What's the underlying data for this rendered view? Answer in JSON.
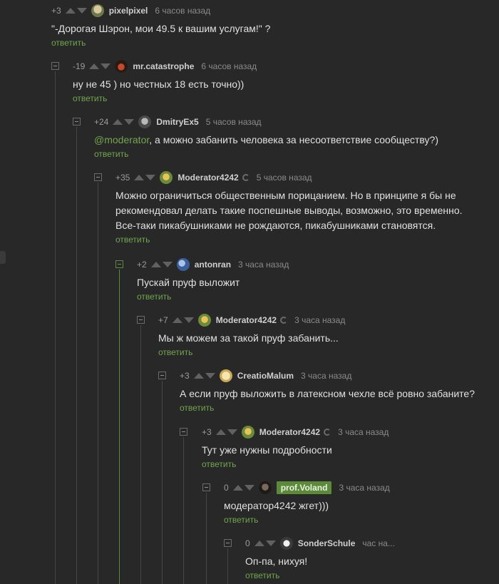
{
  "colors": {
    "background": "#282828",
    "accent": "#5b8a3a",
    "link": "#6fa64b",
    "text": "#e0e0e0",
    "muted": "#8a8a8a"
  },
  "comments": [
    {
      "rating": "+3",
      "username": "pixelpixel",
      "time": "6 часов назад",
      "text": "\"-Дорогая Шэрон, мои 49.5 к вашим услугам!\" ?",
      "reply": "ответить"
    },
    {
      "rating": "-19",
      "username": "mr.catastrophe",
      "time": "6 часов назад",
      "text": "ну не 45 ) но честных 18  есть точно))",
      "reply": "ответить"
    },
    {
      "rating": "+24",
      "username": "DmitryEx5",
      "time": "5 часов назад",
      "mention": "@moderator",
      "text": ", а можно забанить человека за несоответствие сообществу?)",
      "reply": "ответить"
    },
    {
      "rating": "+35",
      "username": "Moderator4242",
      "time": "5 часов назад",
      "text_lines": [
        "Можно ограничиться общественным порицанием. Но в принципе я бы не",
        "рекомендовал делать такие поспешные выводы, возможно, это временно.",
        "Все-таки пикабушниками не рождаются, пикабушниками становятся."
      ],
      "reply": "ответить"
    },
    {
      "rating": "+2",
      "username": "antonran",
      "time": "3 часа назад",
      "text": "Пускай пруф выложит",
      "reply": "ответить"
    },
    {
      "rating": "+7",
      "username": "Moderator4242",
      "time": "3 часа назад",
      "text": "Мы ж можем за такой пруф забанить...",
      "reply": "ответить"
    },
    {
      "rating": "+3",
      "username": "CreatioMalum",
      "time": "3 часа назад",
      "text": "А если пруф выложить в латексном чехле всё ровно забаните?",
      "reply": "ответить"
    },
    {
      "rating": "+3",
      "username": "Moderator4242",
      "time": "3 часа назад",
      "text": "Тут уже нужны подробности",
      "reply": "ответить"
    },
    {
      "rating": "0",
      "username": "prof.Voland",
      "time": "3 часа назад",
      "text": "модератор4242 жгет)))",
      "reply": "ответить"
    },
    {
      "rating": "0",
      "username": "SonderSchule",
      "time": "час на...",
      "text": "Оп-па, нихуя!",
      "reply": "ответить"
    }
  ]
}
